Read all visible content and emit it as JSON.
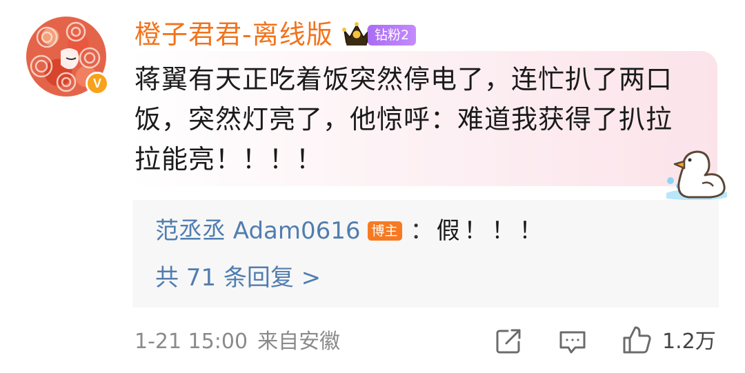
{
  "comment": {
    "username": "橙子君君-离线版",
    "fan_badge": "钻粉2",
    "verified_mark": "V",
    "text": "蒋翼有天正吃着饭突然停电了，连忙扒了两口饭，突然灯亮了，他惊呼：难道我获得了扒拉拉能亮！！！！",
    "icons": {
      "crown": "crown-icon",
      "verified": "verified-icon",
      "duck_sticker": "duck-sticker-icon"
    }
  },
  "reply_preview": {
    "user": "范丞丞 Adam0616",
    "badge": "博主",
    "colon": "：",
    "text": "假！！！",
    "more_label": "共 71 条回复 >"
  },
  "meta": {
    "time": "1-21 15:00",
    "location": "来自安徽"
  },
  "actions": {
    "share_icon": "share-icon",
    "comment_icon": "comment-icon",
    "like_icon": "thumbs-up-icon",
    "like_count": "1.2万"
  },
  "colors": {
    "username": "#f2731c",
    "link_blue": "#507daf",
    "fan_badge": "#b77bf7",
    "blogger_badge": "#f77a22",
    "meta_gray": "#8a8a8a"
  }
}
